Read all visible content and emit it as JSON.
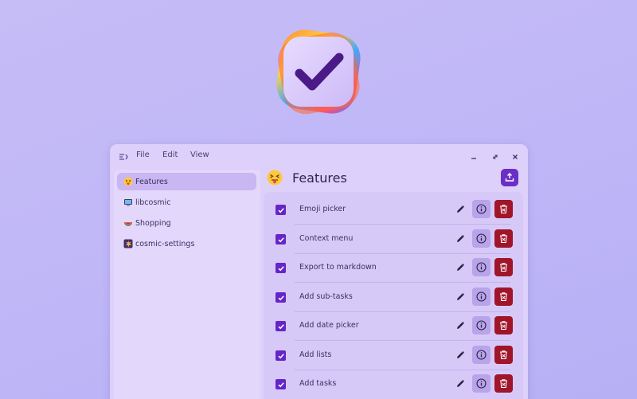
{
  "menu": {
    "file": "File",
    "edit": "Edit",
    "view": "View"
  },
  "sidebar": {
    "items": [
      {
        "label": "Features",
        "emoji": "squinting-tongue-face",
        "active": true
      },
      {
        "label": "libcosmic",
        "emoji": "desktop-computer",
        "active": false
      },
      {
        "label": "Shopping",
        "emoji": "watermelon",
        "active": false
      },
      {
        "label": "cosmic-settings",
        "emoji": "exploding-star",
        "active": false
      }
    ]
  },
  "header": {
    "title": "Features",
    "emoji": "squinting-tongue-face"
  },
  "tasks": [
    {
      "label": "Emoji picker",
      "checked": true
    },
    {
      "label": "Context menu",
      "checked": true
    },
    {
      "label": "Export to markdown",
      "checked": true
    },
    {
      "label": "Add sub-tasks",
      "checked": true
    },
    {
      "label": "Add date picker",
      "checked": true
    },
    {
      "label": "Add lists",
      "checked": true
    },
    {
      "label": "Add tasks",
      "checked": true
    }
  ],
  "colors": {
    "accent": "#6526c8",
    "delete": "#a01529",
    "info": "#b7a4ea",
    "window": "#ddd0fa",
    "background": "#c1b8f7"
  }
}
